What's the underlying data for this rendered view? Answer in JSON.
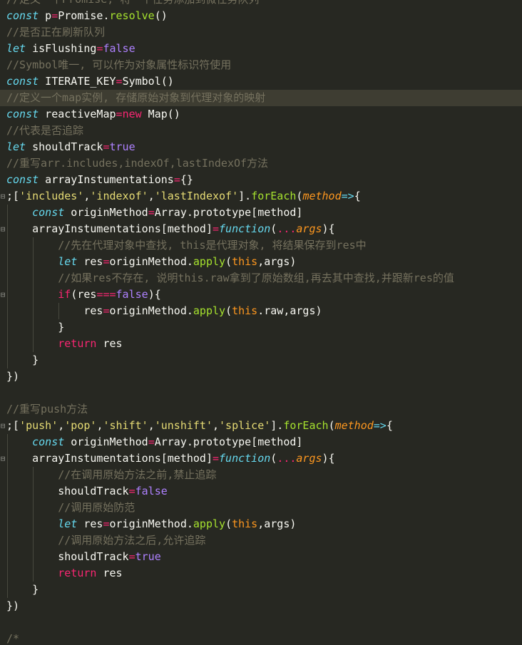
{
  "editor": {
    "theme_colors": {
      "background": "#272822",
      "highlight_line": "#3E3D32",
      "comment": "#75715E",
      "keyword": "#F92672",
      "storage": "#66D9EF",
      "string": "#E6DB74",
      "function": "#A6E22E",
      "parameter": "#FD971F",
      "constant": "#AE81FF",
      "text": "#F8F8F2",
      "fold_marker": "#8F908A"
    },
    "lines": [
      {
        "tokens": [
          {
            "t": "//定义一个Promise, 将一个任务添加到微任务队列",
            "c": "comment"
          }
        ]
      },
      {
        "tokens": [
          {
            "t": "const",
            "c": "storage"
          },
          {
            "t": " p",
            "c": "plain"
          },
          {
            "t": "=",
            "c": "operator"
          },
          {
            "t": "Promise",
            "c": "plain"
          },
          {
            "t": ".",
            "c": "plain"
          },
          {
            "t": "resolve",
            "c": "func"
          },
          {
            "t": "()",
            "c": "plain"
          }
        ]
      },
      {
        "tokens": [
          {
            "t": "//是否正在刷新队列",
            "c": "comment"
          }
        ]
      },
      {
        "tokens": [
          {
            "t": "let",
            "c": "storage"
          },
          {
            "t": " isFlushing",
            "c": "plain"
          },
          {
            "t": "=",
            "c": "operator"
          },
          {
            "t": "false",
            "c": "const"
          }
        ]
      },
      {
        "tokens": [
          {
            "t": "//Symbol唯一, 可以作为对象属性标识符使用",
            "c": "comment"
          }
        ]
      },
      {
        "tokens": [
          {
            "t": "const",
            "c": "storage"
          },
          {
            "t": " ITERATE_KEY",
            "c": "plain"
          },
          {
            "t": "=",
            "c": "operator"
          },
          {
            "t": "Symbol()",
            "c": "plain"
          }
        ]
      },
      {
        "highlight": true,
        "tokens": [
          {
            "t": "//定义一个map实例, 存储原始对象到代理对象的映射",
            "c": "comment"
          }
        ]
      },
      {
        "tokens": [
          {
            "t": "const",
            "c": "storage"
          },
          {
            "t": " reactiveMap",
            "c": "plain"
          },
          {
            "t": "=",
            "c": "operator"
          },
          {
            "t": "new",
            "c": "keyword"
          },
          {
            "t": " Map()",
            "c": "plain"
          }
        ]
      },
      {
        "tokens": [
          {
            "t": "//代表是否追踪",
            "c": "comment"
          }
        ]
      },
      {
        "tokens": [
          {
            "t": "let",
            "c": "storage"
          },
          {
            "t": " shouldTrack",
            "c": "plain"
          },
          {
            "t": "=",
            "c": "operator"
          },
          {
            "t": "true",
            "c": "const"
          }
        ]
      },
      {
        "tokens": [
          {
            "t": "//重写arr.includes,indexOf,lastIndexOf方法",
            "c": "comment"
          }
        ]
      },
      {
        "tokens": [
          {
            "t": "const",
            "c": "storage"
          },
          {
            "t": " arrayInstumentations",
            "c": "plain"
          },
          {
            "t": "=",
            "c": "operator"
          },
          {
            "t": "{}",
            "c": "plain"
          }
        ]
      },
      {
        "fold": true,
        "tokens": [
          {
            "t": ";[",
            "c": "plain"
          },
          {
            "t": "'includes'",
            "c": "string"
          },
          {
            "t": ",",
            "c": "plain"
          },
          {
            "t": "'indexof'",
            "c": "string"
          },
          {
            "t": ",",
            "c": "plain"
          },
          {
            "t": "'lastIndexof'",
            "c": "string"
          },
          {
            "t": "].",
            "c": "plain"
          },
          {
            "t": "forEach",
            "c": "func"
          },
          {
            "t": "(",
            "c": "plain"
          },
          {
            "t": "method",
            "c": "param"
          },
          {
            "t": "=>",
            "c": "storage"
          },
          {
            "t": "{",
            "c": "plain"
          }
        ]
      },
      {
        "indent": 1,
        "tokens": [
          {
            "t": "const",
            "c": "storage"
          },
          {
            "t": " originMethod",
            "c": "plain"
          },
          {
            "t": "=",
            "c": "operator"
          },
          {
            "t": "Array.prototype[method]",
            "c": "plain"
          }
        ]
      },
      {
        "indent": 1,
        "fold": true,
        "tokens": [
          {
            "t": "arrayInstumentations[method]",
            "c": "plain"
          },
          {
            "t": "=",
            "c": "operator"
          },
          {
            "t": "function",
            "c": "storage"
          },
          {
            "t": "(",
            "c": "plain"
          },
          {
            "t": "...",
            "c": "operator"
          },
          {
            "t": "args",
            "c": "param"
          },
          {
            "t": "){",
            "c": "plain"
          }
        ]
      },
      {
        "indent": 2,
        "tokens": [
          {
            "t": "//先在代理对象中查找, this是代理对象, 将结果保存到res中",
            "c": "comment"
          }
        ]
      },
      {
        "indent": 2,
        "tokens": [
          {
            "t": "let",
            "c": "storage"
          },
          {
            "t": " res",
            "c": "plain"
          },
          {
            "t": "=",
            "c": "operator"
          },
          {
            "t": "originMethod.",
            "c": "plain"
          },
          {
            "t": "apply",
            "c": "func"
          },
          {
            "t": "(",
            "c": "plain"
          },
          {
            "t": "this",
            "c": "this"
          },
          {
            "t": ",args)",
            "c": "plain"
          }
        ]
      },
      {
        "indent": 2,
        "tokens": [
          {
            "t": "//如果res不存在, 说明this.raw拿到了原始数组,再去其中查找,并跟新res的值",
            "c": "comment"
          }
        ]
      },
      {
        "indent": 2,
        "fold": true,
        "tokens": [
          {
            "t": "if",
            "c": "keyword"
          },
          {
            "t": "(res",
            "c": "plain"
          },
          {
            "t": "===",
            "c": "operator"
          },
          {
            "t": "false",
            "c": "const"
          },
          {
            "t": "){",
            "c": "plain"
          }
        ]
      },
      {
        "indent": 3,
        "tokens": [
          {
            "t": "res",
            "c": "plain"
          },
          {
            "t": "=",
            "c": "operator"
          },
          {
            "t": "originMethod.",
            "c": "plain"
          },
          {
            "t": "apply",
            "c": "func"
          },
          {
            "t": "(",
            "c": "plain"
          },
          {
            "t": "this",
            "c": "this"
          },
          {
            "t": ".raw,args)",
            "c": "plain"
          }
        ]
      },
      {
        "indent": 2,
        "tokens": [
          {
            "t": "}",
            "c": "plain"
          }
        ]
      },
      {
        "indent": 2,
        "tokens": [
          {
            "t": "return",
            "c": "keyword"
          },
          {
            "t": " res",
            "c": "plain"
          }
        ]
      },
      {
        "indent": 1,
        "tokens": [
          {
            "t": "}",
            "c": "plain"
          }
        ]
      },
      {
        "tokens": [
          {
            "t": "})",
            "c": "plain"
          }
        ]
      },
      {
        "tokens": []
      },
      {
        "tokens": [
          {
            "t": "//重写push方法",
            "c": "comment"
          }
        ]
      },
      {
        "fold": true,
        "tokens": [
          {
            "t": ";[",
            "c": "plain"
          },
          {
            "t": "'push'",
            "c": "string"
          },
          {
            "t": ",",
            "c": "plain"
          },
          {
            "t": "'pop'",
            "c": "string"
          },
          {
            "t": ",",
            "c": "plain"
          },
          {
            "t": "'shift'",
            "c": "string"
          },
          {
            "t": ",",
            "c": "plain"
          },
          {
            "t": "'unshift'",
            "c": "string"
          },
          {
            "t": ",",
            "c": "plain"
          },
          {
            "t": "'splice'",
            "c": "string"
          },
          {
            "t": "].",
            "c": "plain"
          },
          {
            "t": "forEach",
            "c": "func"
          },
          {
            "t": "(",
            "c": "plain"
          },
          {
            "t": "method",
            "c": "param"
          },
          {
            "t": "=>",
            "c": "storage"
          },
          {
            "t": "{",
            "c": "plain"
          }
        ]
      },
      {
        "indent": 1,
        "tokens": [
          {
            "t": "const",
            "c": "storage"
          },
          {
            "t": " originMethod",
            "c": "plain"
          },
          {
            "t": "=",
            "c": "operator"
          },
          {
            "t": "Array.prototype[method]",
            "c": "plain"
          }
        ]
      },
      {
        "indent": 1,
        "fold": true,
        "tokens": [
          {
            "t": "arrayInstumentations[method]",
            "c": "plain"
          },
          {
            "t": "=",
            "c": "operator"
          },
          {
            "t": "function",
            "c": "storage"
          },
          {
            "t": "(",
            "c": "plain"
          },
          {
            "t": "...",
            "c": "operator"
          },
          {
            "t": "args",
            "c": "param"
          },
          {
            "t": "){",
            "c": "plain"
          }
        ]
      },
      {
        "indent": 2,
        "tokens": [
          {
            "t": "//在调用原始方法之前,禁止追踪",
            "c": "comment"
          }
        ]
      },
      {
        "indent": 2,
        "tokens": [
          {
            "t": "shouldTrack",
            "c": "plain"
          },
          {
            "t": "=",
            "c": "operator"
          },
          {
            "t": "false",
            "c": "const"
          }
        ]
      },
      {
        "indent": 2,
        "tokens": [
          {
            "t": "//调用原始防范",
            "c": "comment"
          }
        ]
      },
      {
        "indent": 2,
        "tokens": [
          {
            "t": "let",
            "c": "storage"
          },
          {
            "t": " res",
            "c": "plain"
          },
          {
            "t": "=",
            "c": "operator"
          },
          {
            "t": "originMethod.",
            "c": "plain"
          },
          {
            "t": "apply",
            "c": "func"
          },
          {
            "t": "(",
            "c": "plain"
          },
          {
            "t": "this",
            "c": "this"
          },
          {
            "t": ",args)",
            "c": "plain"
          }
        ]
      },
      {
        "indent": 2,
        "tokens": [
          {
            "t": "//调用原始方法之后,允许追踪",
            "c": "comment"
          }
        ]
      },
      {
        "indent": 2,
        "tokens": [
          {
            "t": "shouldTrack",
            "c": "plain"
          },
          {
            "t": "=",
            "c": "operator"
          },
          {
            "t": "true",
            "c": "const"
          }
        ]
      },
      {
        "indent": 2,
        "tokens": [
          {
            "t": "return",
            "c": "keyword"
          },
          {
            "t": " res",
            "c": "plain"
          }
        ]
      },
      {
        "indent": 1,
        "tokens": [
          {
            "t": "}",
            "c": "plain"
          }
        ]
      },
      {
        "tokens": [
          {
            "t": "})",
            "c": "plain"
          }
        ]
      },
      {
        "tokens": []
      },
      {
        "tokens": [
          {
            "t": "/*",
            "c": "comment"
          }
        ]
      }
    ]
  }
}
